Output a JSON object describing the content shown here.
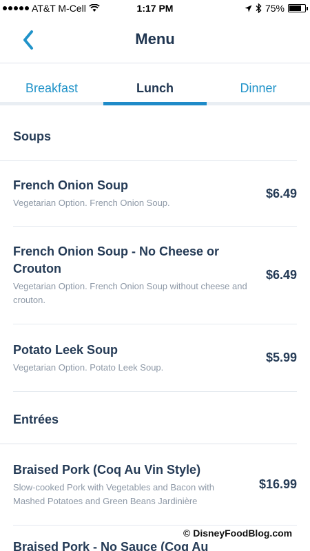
{
  "status_bar": {
    "carrier": "AT&T M-Cell",
    "time": "1:17 PM",
    "battery_text": "75%",
    "battery_level": 0.75,
    "icons": [
      "signal-dots-icon",
      "wifi-icon",
      "location-arrow-icon",
      "bluetooth-icon",
      "battery-icon"
    ]
  },
  "nav": {
    "title": "Menu",
    "back_icon": "chevron-left-icon"
  },
  "tabs": [
    {
      "label": "Breakfast",
      "active": false
    },
    {
      "label": "Lunch",
      "active": true
    },
    {
      "label": "Dinner",
      "active": false
    }
  ],
  "sections": [
    {
      "title": "Soups",
      "items": [
        {
          "name": "French Onion Soup",
          "description": "Vegetarian Option.  French Onion Soup.",
          "price": "$6.49"
        },
        {
          "name": "French Onion Soup - No Cheese or Crouton",
          "description": "Vegetarian Option. French Onion Soup without cheese and crouton.",
          "price": "$6.49"
        },
        {
          "name": "Potato Leek Soup",
          "description": "Vegetarian Option.  Potato Leek Soup.",
          "price": "$5.99"
        }
      ]
    },
    {
      "title": "Entrées",
      "items": [
        {
          "name": "Braised Pork (Coq Au Vin Style)",
          "description": "Slow-cooked Pork with Vegetables and Bacon with Mashed Potatoes and Green Beans Jardinière",
          "price": "$16.99"
        }
      ]
    }
  ],
  "partial_item": "Braised Pork - No Sauce (Coq Au",
  "watermark": "© DisneyFoodBlog.com",
  "colors": {
    "accent": "#1f8bc8",
    "link": "#2093c9",
    "text": "#253b56",
    "muted": "#8d98a6"
  }
}
